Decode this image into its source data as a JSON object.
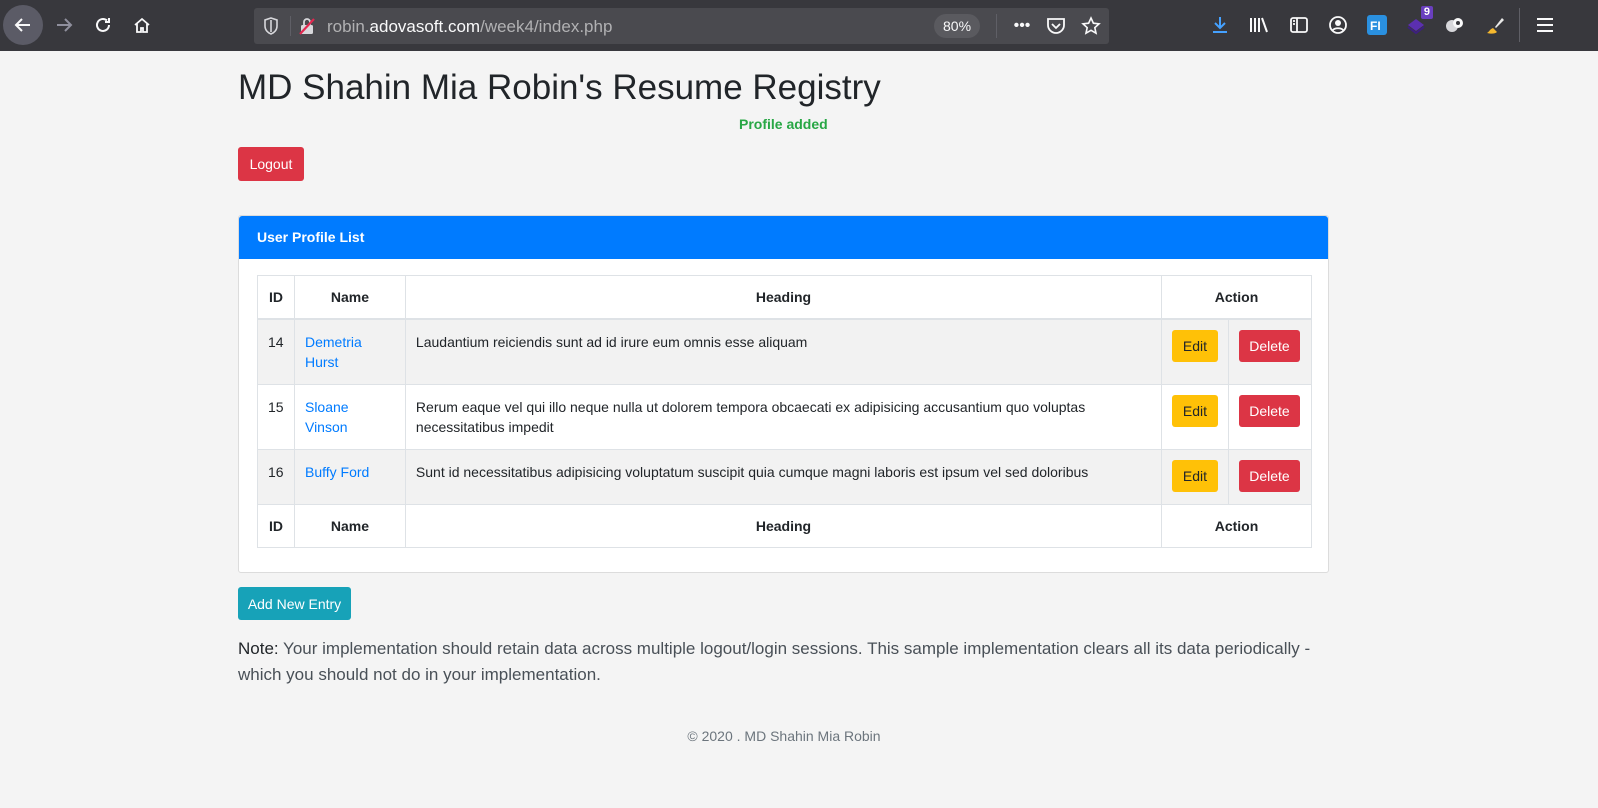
{
  "browser": {
    "url_prefix": "robin.",
    "url_domain": "adovasoft.com",
    "url_path": "/week4/index.php",
    "zoom": "80%",
    "extension_badge": "9"
  },
  "page": {
    "title": "MD Shahin Mia Robin's Resume Registry",
    "flash": "Profile added",
    "logout_label": "Logout",
    "add_label": "Add New Entry",
    "note_label": "Note:",
    "note_text": " Your implementation should retain data across multiple logout/login sessions. This sample implementation clears all its data periodically - which you should not do in your implementation.",
    "footer": "© 2020 . MD Shahin Mia Robin"
  },
  "card": {
    "header": "User Profile List"
  },
  "table": {
    "columns": [
      "ID",
      "Name",
      "Heading",
      "Action"
    ],
    "rows": [
      {
        "id": "14",
        "name": "Demetria Hurst",
        "heading": "Laudantium reiciendis sunt ad id irure eum omnis esse aliquam",
        "edit": "Edit",
        "delete": "Delete"
      },
      {
        "id": "15",
        "name": "Sloane Vinson",
        "heading": "Rerum eaque vel qui illo neque nulla ut dolorem tempora obcaecati ex adipisicing accusantium quo voluptas necessitatibus impedit",
        "edit": "Edit",
        "delete": "Delete"
      },
      {
        "id": "16",
        "name": "Buffy Ford",
        "heading": "Sunt id necessitatibus adipisicing voluptatum suscipit quia cumque magni laboris est ipsum vel sed doloribus",
        "edit": "Edit",
        "delete": "Delete"
      }
    ]
  },
  "colors": {
    "primary": "#007bff",
    "danger": "#dc3545",
    "warning": "#ffc107",
    "info": "#17a2b8",
    "success": "#28a745"
  }
}
